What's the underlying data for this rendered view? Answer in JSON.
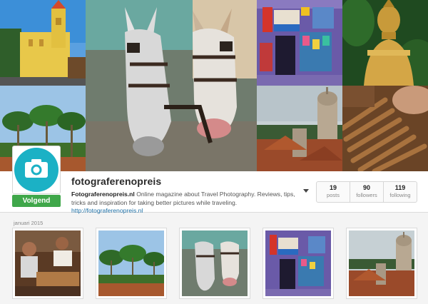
{
  "profile": {
    "username": "fotograferenopreis",
    "follow_label": "Volgend",
    "bio_name": "Fotograferenopreis.nl",
    "bio_text": " Online magazine about Travel Photography. Reviews, tips, tricks and inspiration for taking better pictures while traveling. ",
    "bio_link": "http://fotograferenopreis.nl"
  },
  "stats": [
    {
      "value": "19",
      "label": "posts"
    },
    {
      "value": "90",
      "label": "followers"
    },
    {
      "value": "119",
      "label": "following"
    }
  ],
  "feed": {
    "month_label": "januari 2015"
  },
  "colors": {
    "avatar_bg": "#1bb1c5",
    "follow_bg": "#3fa74a",
    "link": "#1d6fa5"
  },
  "icons": {
    "avatar": "camera-icon",
    "menu": "caret-down-icon"
  }
}
